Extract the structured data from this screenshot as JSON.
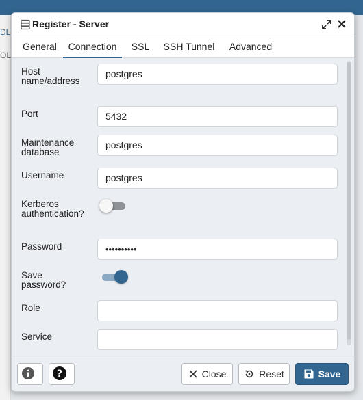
{
  "background": {
    "left_text_1": "DL",
    "left_text_2": "OL"
  },
  "dialog": {
    "title": "Register - Server",
    "tabs": [
      {
        "label": "General",
        "active": false
      },
      {
        "label": "Connection",
        "active": true
      },
      {
        "label": "SSL",
        "active": false
      },
      {
        "label": "SSH Tunnel",
        "active": false
      },
      {
        "label": "Advanced",
        "active": false
      }
    ],
    "fields": {
      "host": {
        "label": "Host name/address",
        "value": "postgres"
      },
      "port": {
        "label": "Port",
        "value": "5432"
      },
      "maintenance_db": {
        "label": "Maintenance database",
        "value": "postgres"
      },
      "username": {
        "label": "Username",
        "value": "postgres"
      },
      "kerberos": {
        "label": "Kerberos authentication?",
        "enabled": false
      },
      "password": {
        "label": "Password",
        "value": "••••••••••"
      },
      "save_password": {
        "label": "Save password?",
        "enabled": true
      },
      "role": {
        "label": "Role",
        "value": ""
      },
      "service": {
        "label": "Service",
        "value": ""
      }
    },
    "footer": {
      "info_icon": "info-icon",
      "help_icon": "help-icon",
      "close_label": "Close",
      "reset_label": "Reset",
      "save_label": "Save"
    }
  },
  "colors": {
    "accent": "#326690",
    "dialog_bg": "#ebeef3",
    "toggle_on_track": "#8ba8c2",
    "toggle_off_track": "#8e9296"
  }
}
